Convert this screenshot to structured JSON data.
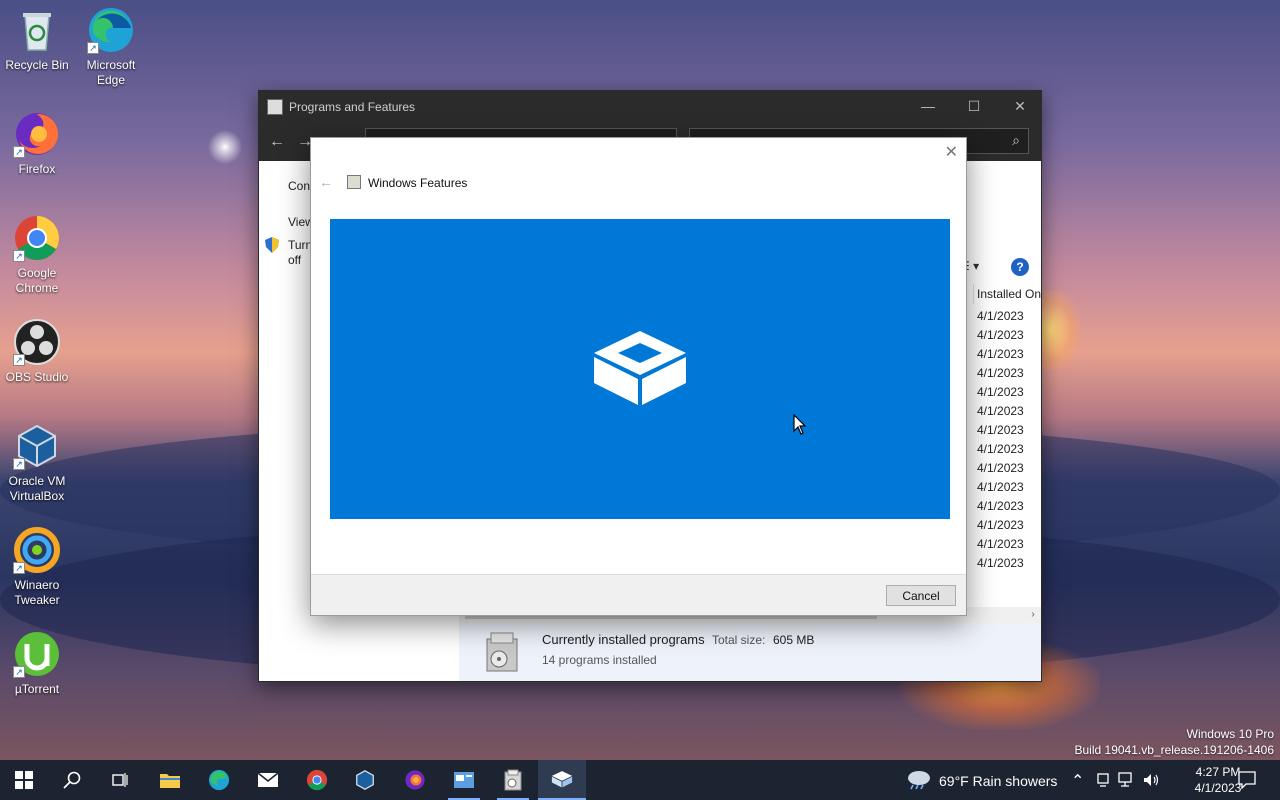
{
  "desktop": {
    "icons": [
      {
        "label": "Recycle Bin",
        "icon": "recycle-bin-icon"
      },
      {
        "label": "Microsoft Edge",
        "icon": "edge-icon"
      },
      {
        "label": "Firefox",
        "icon": "firefox-icon"
      },
      {
        "label": "Google Chrome",
        "icon": "chrome-icon"
      },
      {
        "label": "OBS Studio",
        "icon": "obs-icon"
      },
      {
        "label": "Oracle VM VirtualBox",
        "icon": "virtualbox-icon"
      },
      {
        "label": "Winaero Tweaker",
        "icon": "winaero-icon"
      },
      {
        "label": "µTorrent",
        "icon": "utorrent-icon"
      }
    ]
  },
  "programs_window": {
    "title": "Programs and Features",
    "sidebar_partial": [
      "Cont",
      "View",
      "Turn",
      "off"
    ],
    "column_header": "Installed On",
    "installed_dates": [
      "4/1/2023",
      "4/1/2023",
      "4/1/2023",
      "4/1/2023",
      "4/1/2023",
      "4/1/2023",
      "4/1/2023",
      "4/1/2023",
      "4/1/2023",
      "4/1/2023",
      "4/1/2023",
      "4/1/2023",
      "4/1/2023",
      "4/1/2023"
    ],
    "details": {
      "title": "Currently installed programs",
      "total_size_label": "Total size:",
      "total_size_value": "605 MB",
      "count_text": "14 programs installed"
    }
  },
  "windows_features": {
    "title": "Windows Features",
    "cancel_label": "Cancel",
    "banner_color": "#0078d7"
  },
  "watermark": {
    "line1": "Windows 10 Pro",
    "line2": "Build 19041.vb_release.191206-1406"
  },
  "taskbar": {
    "weather": "69°F  Rain showers",
    "time": "4:27 PM",
    "date": "4/1/2023",
    "pinned": [
      "start-icon",
      "search-icon",
      "task-view-icon",
      "file-explorer-icon",
      "edge-icon",
      "mail-icon",
      "chrome-icon",
      "virtualbox-icon",
      "firefox-icon",
      "control-panel-icon",
      "programs-features-icon",
      "windows-features-icon"
    ]
  }
}
